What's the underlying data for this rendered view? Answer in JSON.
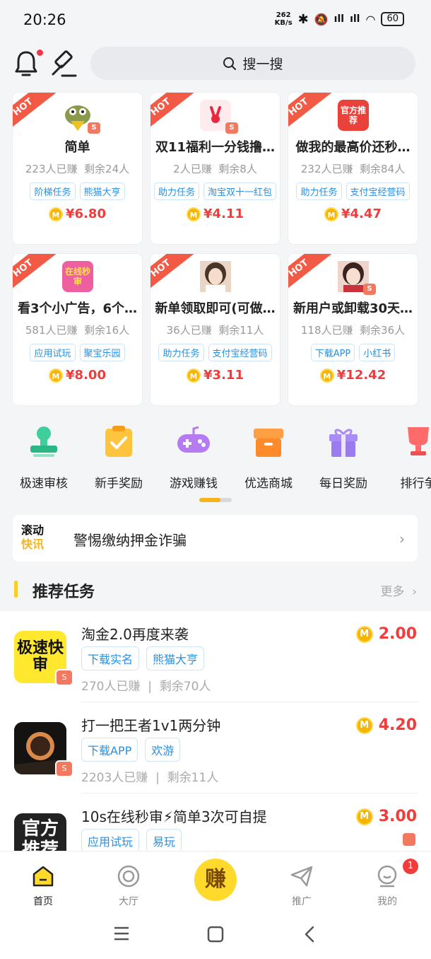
{
  "status": {
    "time": "20:26",
    "net_speed": "262",
    "net_unit": "KB/s",
    "battery": "60"
  },
  "search": {
    "placeholder": "搜一搜"
  },
  "cards": [
    {
      "title": "简单",
      "earned": "223人已赚",
      "left": "剩余24人",
      "tags": [
        "阶梯任务",
        "熊猫大亨"
      ],
      "price": "¥6.80"
    },
    {
      "title": "双11福利一分钱撸…",
      "earned": "2人已赚",
      "left": "剩余8人",
      "tags": [
        "助力任务",
        "淘宝双十一红包"
      ],
      "price": "¥4.11"
    },
    {
      "title": "做我的最高价还秒…",
      "earned": "232人已赚",
      "left": "剩余84人",
      "tags": [
        "助力任务",
        "支付宝经营码"
      ],
      "price": "¥4.47"
    },
    {
      "title": "看3个小广告，6个…",
      "earned": "581人已赚",
      "left": "剩余16人",
      "tags": [
        "应用试玩",
        "聚宝乐园"
      ],
      "price": "¥8.00"
    },
    {
      "title": "新单领取即可(可做…",
      "earned": "36人已赚",
      "left": "剩余11人",
      "tags": [
        "助力任务",
        "支付宝经营码"
      ],
      "price": "¥3.11"
    },
    {
      "title": "新用户或卸载30天…",
      "earned": "118人已赚",
      "left": "剩余36人",
      "tags": [
        "下载APP",
        "小红书"
      ],
      "price": "¥12.42"
    }
  ],
  "hot_label": "HOT",
  "card_thumb_text": {
    "c3": "官方推荐",
    "c4": "在线秒审"
  },
  "categories": [
    "极速审核",
    "新手奖励",
    "游戏赚钱",
    "优选商城",
    "每日奖励",
    "排行争"
  ],
  "news": {
    "logo_line1": "滚动",
    "logo_line2": "快讯",
    "text": "警惕缴纳押金诈骗"
  },
  "section": {
    "title": "推荐任务",
    "more": "更多"
  },
  "tasks": [
    {
      "title": "淘金2.0再度来袭",
      "tags": [
        "下载实名",
        "熊猫大亨"
      ],
      "earned": "270人已赚",
      "left": "剩余70人",
      "price": "2.00",
      "icon_text": "极速快审"
    },
    {
      "title": "打一把王者1v1两分钟",
      "tags": [
        "下载APP",
        "欢游"
      ],
      "earned": "2203人已赚",
      "left": "剩余11人",
      "price": "4.20",
      "icon_text": ""
    },
    {
      "title": "10s在线秒审⚡简单3次可自提",
      "tags": [
        "应用试玩",
        "易玩"
      ],
      "earned": "",
      "left": "",
      "price": "3.00",
      "icon_text": "官方推荐"
    }
  ],
  "tabs": {
    "home": "首页",
    "hall": "大厅",
    "earn": "赚",
    "promote": "推广",
    "mine": "我的",
    "badge": "1"
  },
  "colors": {
    "accent": "#f6cf2b",
    "price": "#f23c3c",
    "tag": "#2b8fe0",
    "hot": "#f25a45"
  }
}
